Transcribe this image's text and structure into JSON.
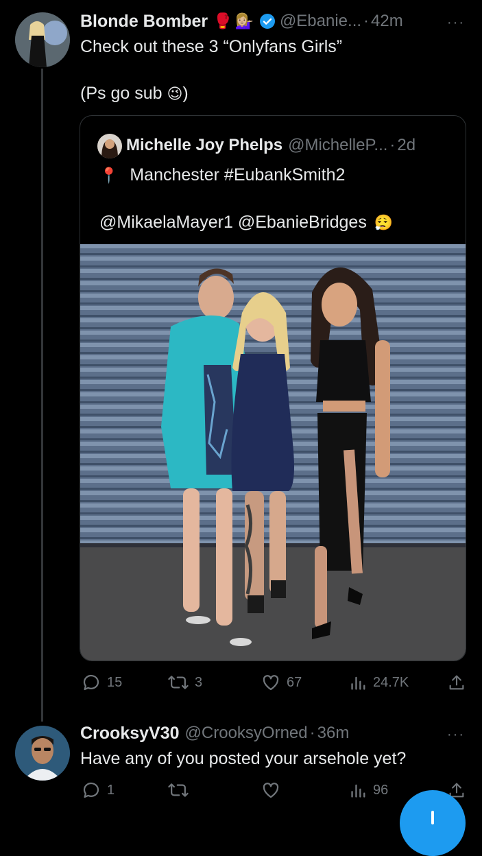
{
  "tweet1": {
    "display_name": "Blonde Bomber",
    "emojis": [
      "🥊",
      "💁🏼‍♀️"
    ],
    "handle": "@Ebanie...",
    "separator": "·",
    "time": "42m",
    "text_line1": "Check out these 3  “Onlyfans Girls”",
    "text_line2": "(Ps go sub",
    "text_line2_end": ")",
    "wink_emoji": "😉",
    "more": "···",
    "verified": true
  },
  "quote": {
    "display_name": "Michelle Joy Phelps",
    "handle": "@MichelleP...",
    "separator": "·",
    "time": "2d",
    "pin_emoji": "📍",
    "location_text": "Manchester #EubankSmith2",
    "mentions": "@MikaelaMayer1 @EbanieBridges",
    "end_emoji": "😮‍💨"
  },
  "tweet1_actions": {
    "replies": "15",
    "retweets": "3",
    "likes": "67",
    "views": "24.7K"
  },
  "tweet2": {
    "display_name": "CrooksyV30",
    "handle": "@CrooksyOrned",
    "separator": "·",
    "time": "36m",
    "text": "Have any of you posted your arsehole yet?",
    "more": "···"
  },
  "tweet2_actions": {
    "replies": "1",
    "retweets": "",
    "likes": "",
    "views": "96"
  },
  "colors": {
    "background": "#000000",
    "text": "#e7e9ea",
    "muted": "#71767b",
    "accent": "#1d9bf0",
    "border": "#2f3336"
  }
}
